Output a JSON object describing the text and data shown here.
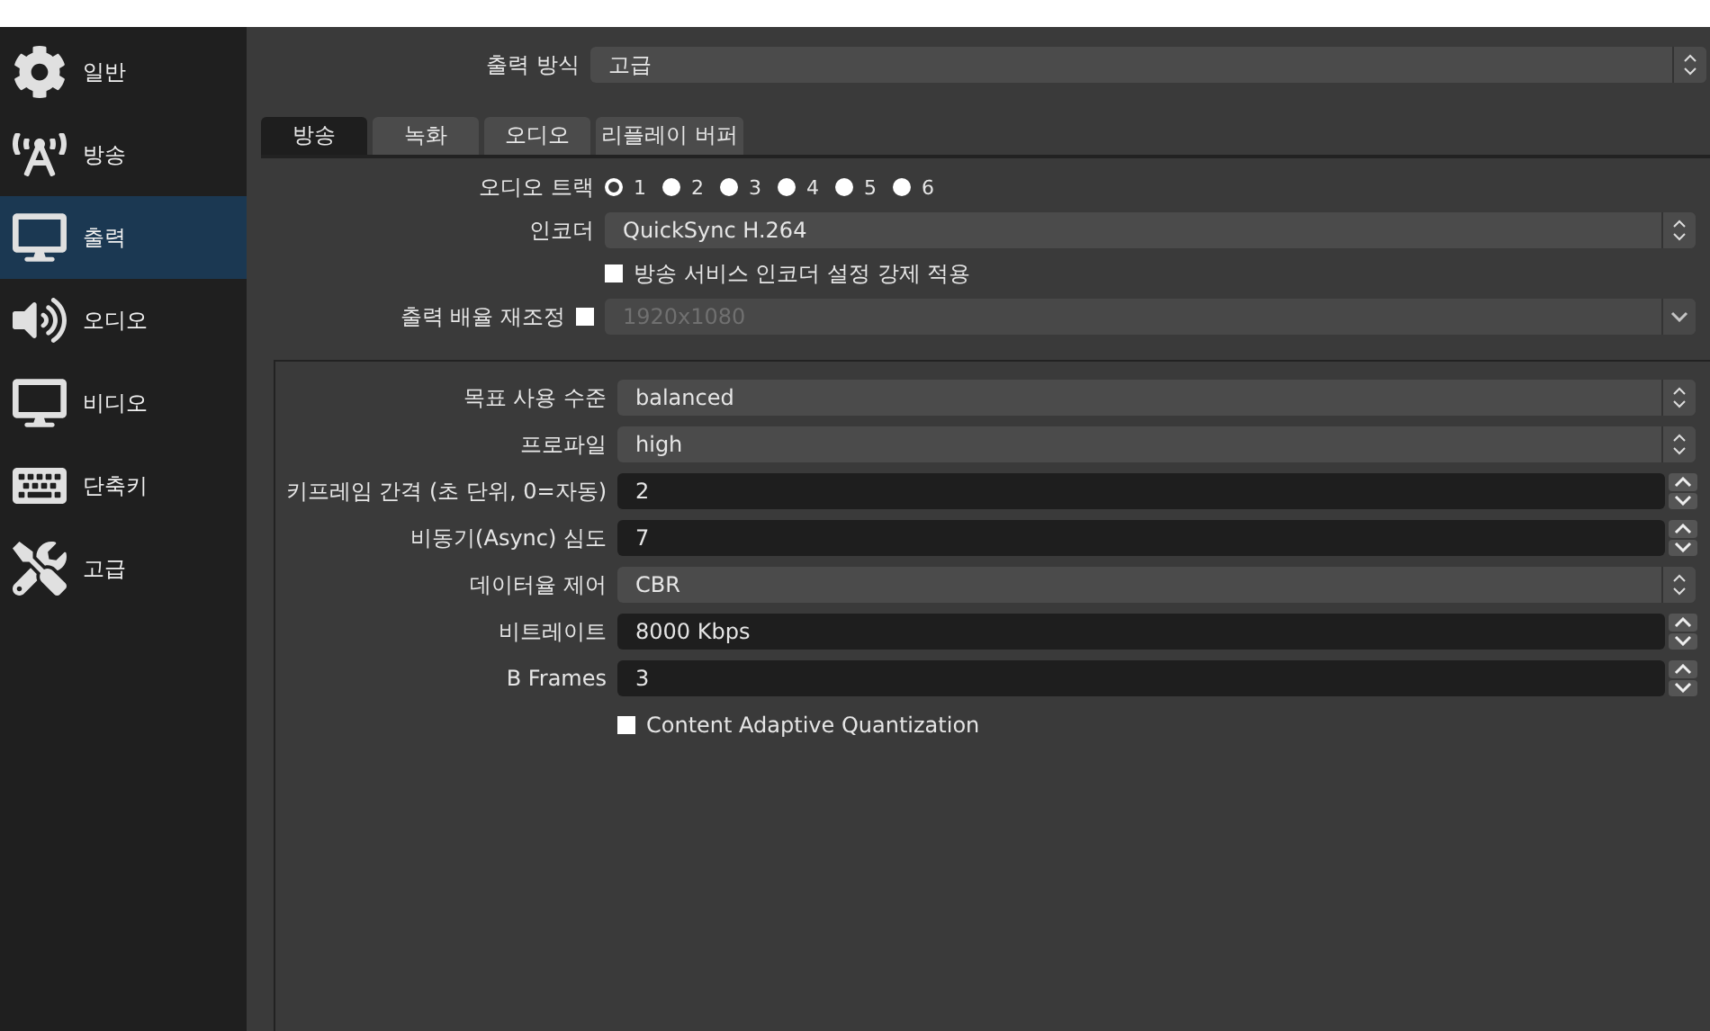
{
  "sidebar": {
    "items": [
      {
        "label": "일반",
        "selected": false
      },
      {
        "label": "방송",
        "selected": false
      },
      {
        "label": "출력",
        "selected": true
      },
      {
        "label": "오디오",
        "selected": false
      },
      {
        "label": "비디오",
        "selected": false
      },
      {
        "label": "단축키",
        "selected": false
      },
      {
        "label": "고급",
        "selected": false
      }
    ]
  },
  "output_mode": {
    "label": "출력 방식",
    "value": "고급"
  },
  "tabs": [
    {
      "label": "방송",
      "selected": true
    },
    {
      "label": "녹화",
      "selected": false
    },
    {
      "label": "오디오",
      "selected": false
    },
    {
      "label": "리플레이 버퍼",
      "selected": false
    }
  ],
  "audio_track": {
    "label": "오디오 트랙",
    "tracks": [
      {
        "label": "1",
        "selected": true
      },
      {
        "label": "2",
        "selected": false
      },
      {
        "label": "3",
        "selected": false
      },
      {
        "label": "4",
        "selected": false
      },
      {
        "label": "5",
        "selected": false
      },
      {
        "label": "6",
        "selected": false
      }
    ]
  },
  "encoder": {
    "label": "인코더",
    "value": "QuickSync H.264"
  },
  "enforce": {
    "label": "방송 서비스 인코더 설정 강제 적용",
    "checked": false
  },
  "rescale": {
    "label": "출력 배율 재조정",
    "checked": false,
    "value": "1920x1080",
    "disabled": true
  },
  "settings": [
    {
      "kind": "select",
      "label": "목표 사용 수준",
      "value": "balanced"
    },
    {
      "kind": "select",
      "label": "프로파일",
      "value": "high"
    },
    {
      "kind": "spin",
      "label": "키프레임 간격 (초 단위, 0=자동)",
      "value": "2"
    },
    {
      "kind": "spin",
      "label": "비동기(Async) 심도",
      "value": "7"
    },
    {
      "kind": "select",
      "label": "데이터율 제어",
      "value": "CBR"
    },
    {
      "kind": "spin",
      "label": "비트레이트",
      "value": "8000 Kbps"
    },
    {
      "kind": "spin",
      "label": "B Frames",
      "value": "3"
    }
  ],
  "caq": {
    "label": "Content Adaptive Quantization",
    "checked": false
  }
}
